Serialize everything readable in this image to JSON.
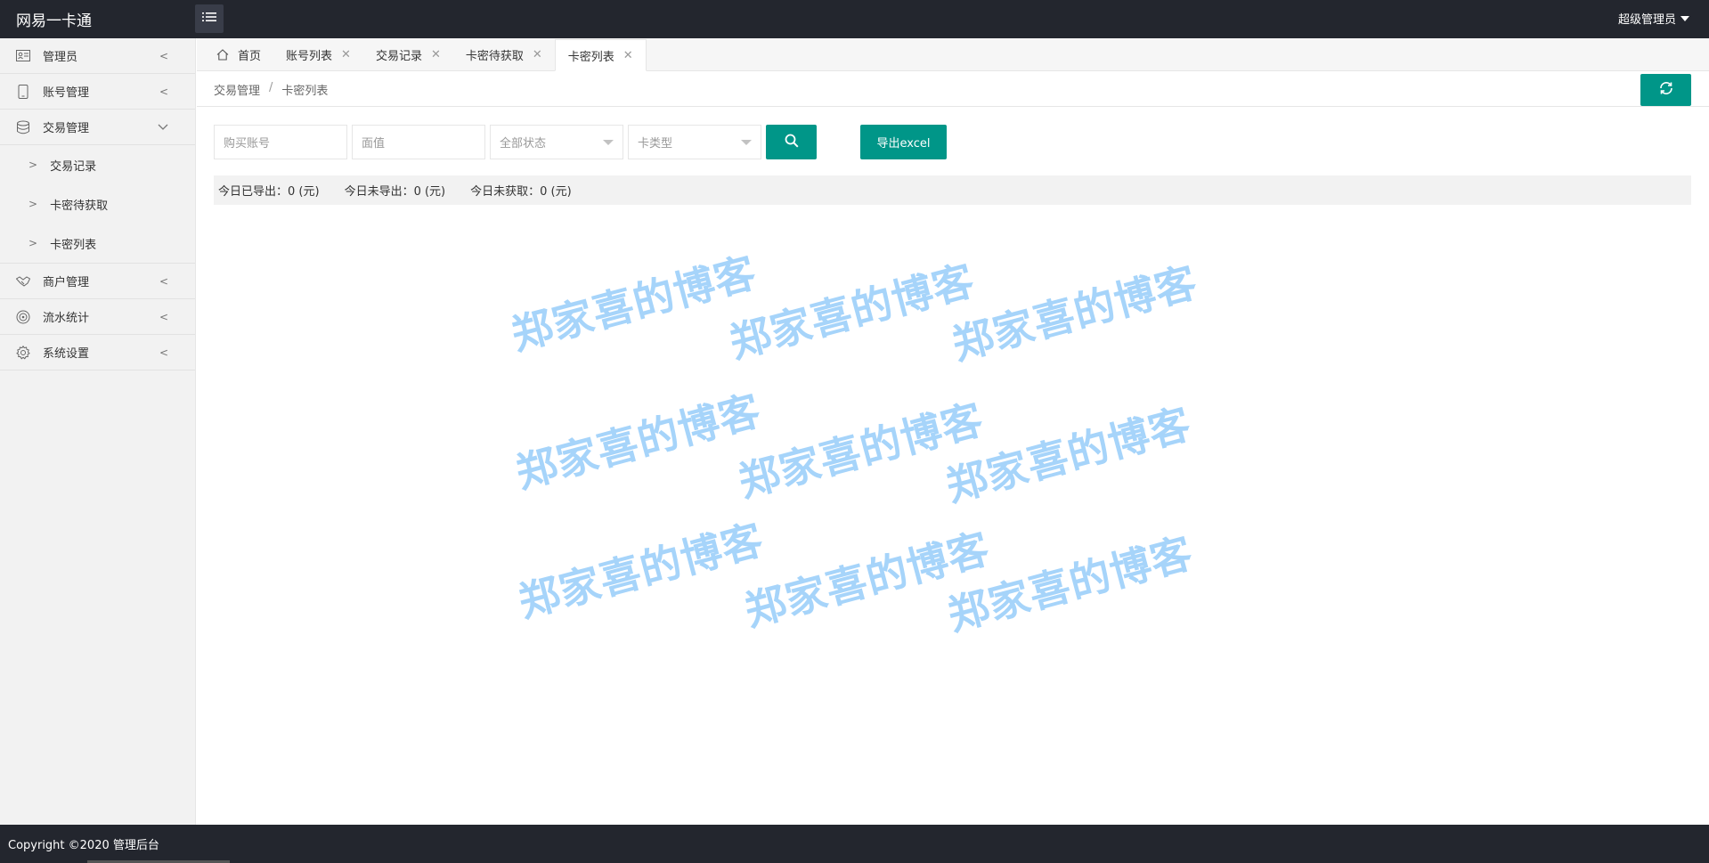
{
  "header": {
    "brand": "网易一卡通",
    "user": "超级管理员"
  },
  "sidebar": {
    "items": [
      {
        "label": "管理员",
        "icon": "id-card-icon"
      },
      {
        "label": "账号管理",
        "icon": "phone-icon"
      },
      {
        "label": "交易管理",
        "icon": "database-icon",
        "expanded": true,
        "children": [
          "交易记录",
          "卡密待获取",
          "卡密列表"
        ]
      },
      {
        "label": "商户管理",
        "icon": "handshake-icon"
      },
      {
        "label": "流水统计",
        "icon": "target-icon"
      },
      {
        "label": "系统设置",
        "icon": "gear-icon"
      }
    ]
  },
  "tabs": [
    {
      "label": "首页",
      "closable": false
    },
    {
      "label": "账号列表",
      "closable": true
    },
    {
      "label": "交易记录",
      "closable": true
    },
    {
      "label": "卡密待获取",
      "closable": true
    },
    {
      "label": "卡密列表",
      "closable": true,
      "active": true
    }
  ],
  "breadcrumb": {
    "parent": "交易管理",
    "separator": "/",
    "current": "卡密列表"
  },
  "filters": {
    "account_placeholder": "购买账号",
    "value_placeholder": "面值",
    "status_selected": "全部状态",
    "card_type_selected": "卡类型",
    "export_label": "导出excel"
  },
  "stats": {
    "exported_today": "今日已导出：0 (元)",
    "not_exported_today": "今日未导出：0 (元)",
    "not_fetched_today": "今日未获取：0 (元)"
  },
  "watermark": "郑家喜的博客",
  "footer": {
    "copyright": "Copyright ©2020 管理后台"
  },
  "colors": {
    "accent": "#009688",
    "header_bg": "#23262e",
    "watermark": "#a6d4fa"
  }
}
